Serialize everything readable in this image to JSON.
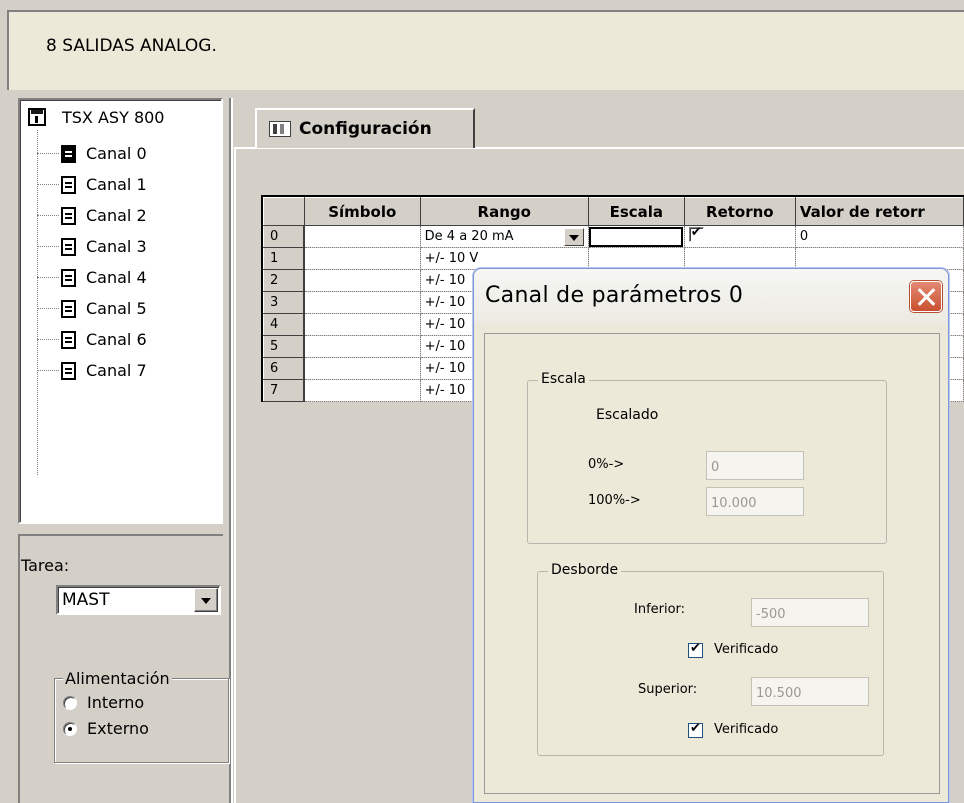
{
  "header": {
    "title": "8 SALIDAS ANALOG."
  },
  "tree": {
    "root": "TSX ASY 800",
    "channels": [
      "Canal 0",
      "Canal 1",
      "Canal 2",
      "Canal 3",
      "Canal 4",
      "Canal 5",
      "Canal 6",
      "Canal 7"
    ]
  },
  "task": {
    "label": "Tarea:",
    "value": "MAST"
  },
  "power": {
    "legend": "Alimentación",
    "options": [
      {
        "label": "Interno",
        "selected": false
      },
      {
        "label": "Externo",
        "selected": true
      }
    ]
  },
  "tab": {
    "label": "Configuración"
  },
  "grid": {
    "columns": [
      "Símbolo",
      "Rango",
      "Escala",
      "Retorno",
      "Valor de retorr"
    ],
    "rows": [
      {
        "index": "0",
        "symbol": "",
        "range": "De 4 a 20 mA",
        "scale": "",
        "fallback": true,
        "fallback_value": "0"
      },
      {
        "index": "1",
        "symbol": "",
        "range": "+/- 10 V"
      },
      {
        "index": "2",
        "symbol": "",
        "range": "+/- 10"
      },
      {
        "index": "3",
        "symbol": "",
        "range": "+/- 10"
      },
      {
        "index": "4",
        "symbol": "",
        "range": "+/- 10"
      },
      {
        "index": "5",
        "symbol": "",
        "range": "+/- 10"
      },
      {
        "index": "6",
        "symbol": "",
        "range": "+/- 10"
      },
      {
        "index": "7",
        "symbol": "",
        "range": "+/- 10"
      }
    ]
  },
  "dialog": {
    "title": "Canal de parámetros 0",
    "scale": {
      "legend": "Escala",
      "heading": "Escalado",
      "zero_label": "0%->",
      "zero_value": "0",
      "full_label": "100%->",
      "full_value": "10.000"
    },
    "overflow": {
      "legend": "Desborde",
      "lower_label": "Inferior:",
      "lower_value": "-500",
      "lower_checked_label": "Verificado",
      "upper_label": "Superior:",
      "upper_value": "10.500",
      "upper_checked_label": "Verificado"
    }
  }
}
